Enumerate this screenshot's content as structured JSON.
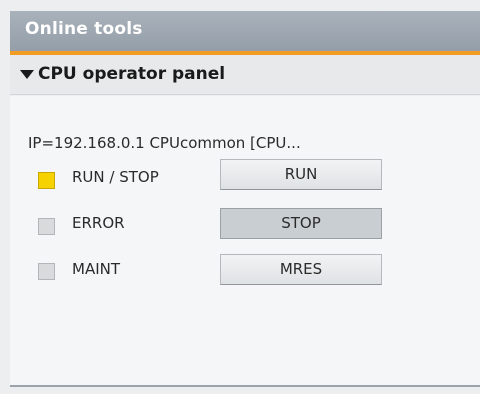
{
  "window": {
    "title": "Online tools"
  },
  "section": {
    "title": "CPU operator panel"
  },
  "device": {
    "info": "IP=192.168.0.1 CPUcommon [CPU..."
  },
  "colors": {
    "accent": "#f39c23",
    "led_on": "#f5d200",
    "led_off": "#d9dadb"
  },
  "leds": [
    {
      "label": "RUN / STOP",
      "state": "on"
    },
    {
      "label": "ERROR",
      "state": "off"
    },
    {
      "label": "MAINT",
      "state": "off"
    }
  ],
  "buttons": [
    {
      "label": "RUN",
      "pressed": false
    },
    {
      "label": "STOP",
      "pressed": true
    },
    {
      "label": "MRES",
      "pressed": false
    }
  ]
}
